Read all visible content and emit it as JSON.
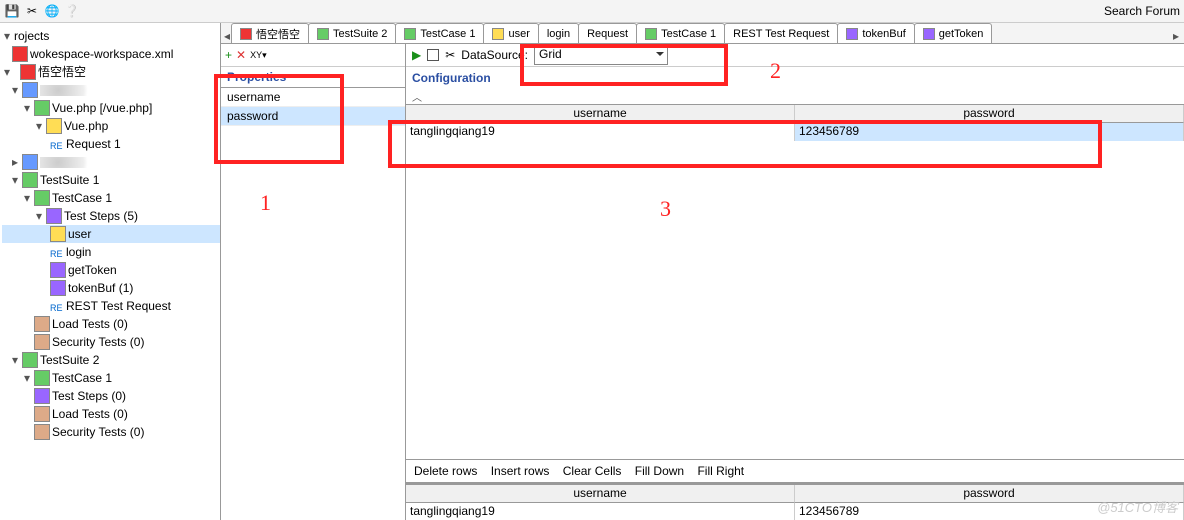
{
  "topbar": {
    "search_forum": "Search Forum"
  },
  "tree": {
    "projects": "rojects",
    "workspace_xml": "wokespace-workspace.xml",
    "project1": "悟空悟空",
    "vue_service": "Vue.php [/vue.php]",
    "vue_resource": "Vue.php",
    "request1": "Request 1",
    "testsuite1": "TestSuite 1",
    "testcase1": "TestCase 1",
    "teststeps5": "Test Steps (5)",
    "step_user": "user",
    "step_login": "login",
    "step_gettoken": "getToken",
    "step_tokenbuf": "tokenBuf (1)",
    "step_rest": "REST Test Request",
    "loadtests0": "Load Tests (0)",
    "sectests0": "Security Tests (0)",
    "testsuite2": "TestSuite 2",
    "testcase1b": "TestCase 1",
    "teststeps0": "Test Steps (0)"
  },
  "tabs": [
    "悟空悟空",
    "TestSuite 2",
    "TestCase 1",
    "user",
    "login",
    "Request",
    "TestCase 1",
    "REST Test Request",
    "tokenBuf",
    "getToken"
  ],
  "properties": {
    "heading": "Properties",
    "items": [
      "username",
      "password"
    ]
  },
  "ds": {
    "label": "DataSource:",
    "type": "Grid",
    "config": "Configuration"
  },
  "grid": {
    "cols": [
      "username",
      "password"
    ],
    "rows": [
      [
        "tanglingqiang19",
        "123456789"
      ]
    ]
  },
  "actions": [
    "Delete rows",
    "Insert rows",
    "Clear Cells",
    "Fill Down",
    "Fill Right"
  ],
  "annot": {
    "1": "1",
    "2": "2",
    "3": "3"
  },
  "watermark": "@51CTO博客"
}
